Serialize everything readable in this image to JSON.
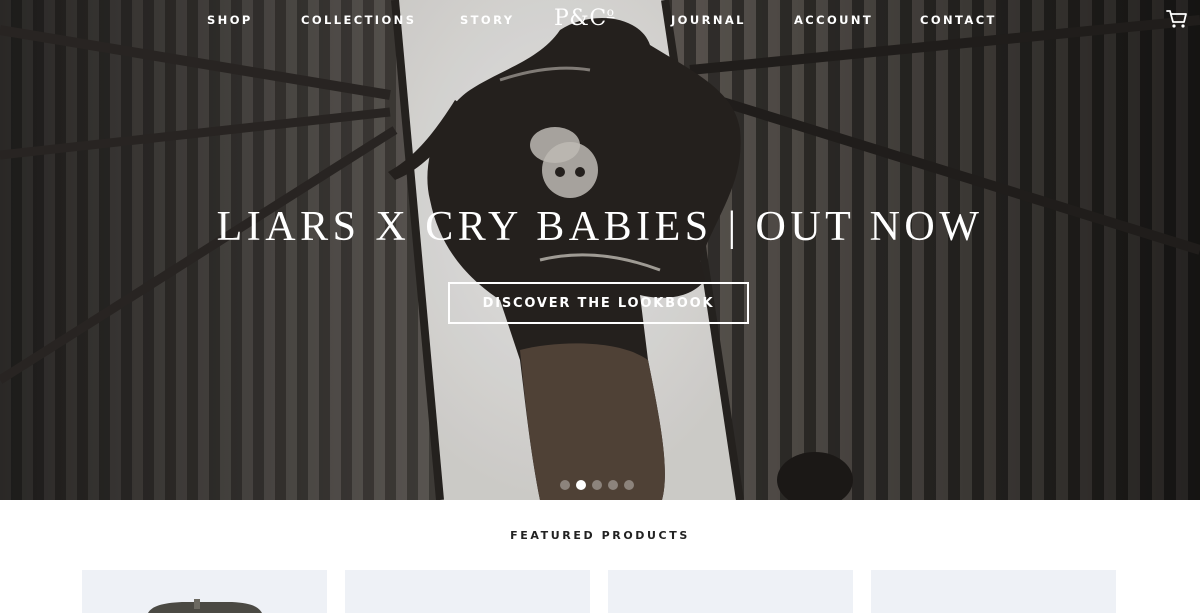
{
  "nav": {
    "links": [
      "SHOP",
      "COLLECTIONS",
      "STORY",
      "JOURNAL",
      "ACCOUNT",
      "CONTACT"
    ],
    "logo": "P&C",
    "logo_superscript": "o",
    "cart_icon": "shopping-cart-icon"
  },
  "hero": {
    "headline": "LIARS X CRY BABIES | OUT NOW",
    "cta_label": "DISCOVER THE LOOKBOOK",
    "slides_count": 5,
    "active_slide": 1
  },
  "featured": {
    "title": "FEATURED PRODUCTS",
    "products_count": 4
  },
  "colors": {
    "nav_text": "#ffffff",
    "card_bg": "#eef1f6",
    "section_title": "#222222"
  }
}
